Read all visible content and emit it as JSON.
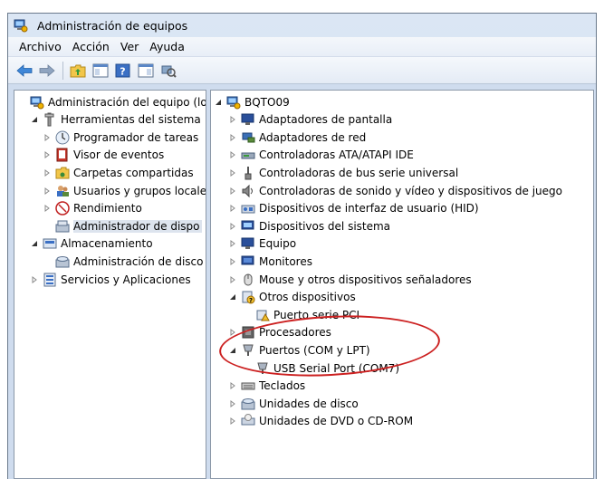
{
  "window": {
    "title": "Administración de equipos"
  },
  "menu": [
    "Archivo",
    "Acción",
    "Ver",
    "Ayuda"
  ],
  "left_tree": [
    {
      "label": "Administración del equipo (loc",
      "level": 0,
      "expander": "none"
    },
    {
      "label": "Herramientas del sistema",
      "level": 1,
      "expander": "open"
    },
    {
      "label": "Programador de tareas",
      "level": 2,
      "expander": "closed"
    },
    {
      "label": "Visor de eventos",
      "level": 2,
      "expander": "closed"
    },
    {
      "label": "Carpetas compartidas",
      "level": 2,
      "expander": "closed"
    },
    {
      "label": "Usuarios y grupos locale",
      "level": 2,
      "expander": "closed"
    },
    {
      "label": "Rendimiento",
      "level": 2,
      "expander": "closed"
    },
    {
      "label": "Administrador de dispo",
      "level": 2,
      "expander": "none",
      "selected": true
    },
    {
      "label": "Almacenamiento",
      "level": 1,
      "expander": "open"
    },
    {
      "label": "Administración de disco",
      "level": 2,
      "expander": "none"
    },
    {
      "label": "Servicios y Aplicaciones",
      "level": 1,
      "expander": "closed"
    }
  ],
  "right_tree": [
    {
      "label": "BQTO09",
      "level": 0,
      "expander": "open"
    },
    {
      "label": "Adaptadores de pantalla",
      "level": 1,
      "expander": "closed"
    },
    {
      "label": "Adaptadores de red",
      "level": 1,
      "expander": "closed"
    },
    {
      "label": "Controladoras ATA/ATAPI IDE",
      "level": 1,
      "expander": "closed"
    },
    {
      "label": "Controladoras de bus serie universal",
      "level": 1,
      "expander": "closed"
    },
    {
      "label": "Controladoras de sonido y vídeo y dispositivos de juego",
      "level": 1,
      "expander": "closed"
    },
    {
      "label": "Dispositivos de interfaz de usuario (HID)",
      "level": 1,
      "expander": "closed"
    },
    {
      "label": "Dispositivos del sistema",
      "level": 1,
      "expander": "closed"
    },
    {
      "label": "Equipo",
      "level": 1,
      "expander": "closed"
    },
    {
      "label": "Monitores",
      "level": 1,
      "expander": "closed"
    },
    {
      "label": "Mouse y otros dispositivos señaladores",
      "level": 1,
      "expander": "closed"
    },
    {
      "label": "Otros dispositivos",
      "level": 1,
      "expander": "open"
    },
    {
      "label": "Puerto serie PCI",
      "level": 2,
      "expander": "none"
    },
    {
      "label": "Procesadores",
      "level": 1,
      "expander": "closed"
    },
    {
      "label": "Puertos (COM y LPT)",
      "level": 1,
      "expander": "open"
    },
    {
      "label": "USB Serial Port (COM7)",
      "level": 2,
      "expander": "none"
    },
    {
      "label": "Teclados",
      "level": 1,
      "expander": "closed"
    },
    {
      "label": "Unidades de disco",
      "level": 1,
      "expander": "closed"
    },
    {
      "label": "Unidades de DVD o CD-ROM",
      "level": 1,
      "expander": "closed"
    }
  ],
  "colors": {
    "highlight_ellipse": "#cc2020",
    "chrome": "#cfdcee",
    "selection": "#dde4ee"
  }
}
